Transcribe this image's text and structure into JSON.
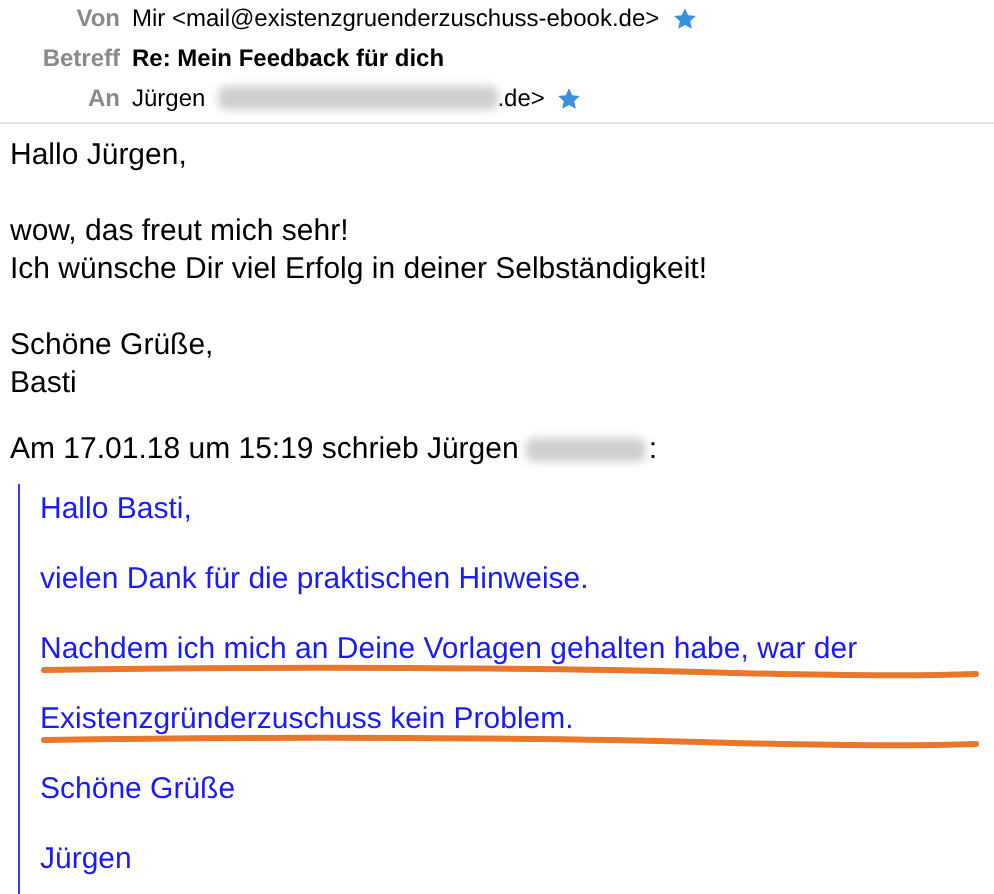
{
  "header": [
    {
      "label": "Von",
      "value": "Mir <mail@existenzgruenderzuschuss-ebook.de>",
      "bold": false,
      "redacted": false,
      "starred": true
    },
    {
      "label": "Betreff",
      "value": "Re: Mein Feedback für dich",
      "bold": true,
      "redacted": false,
      "starred": false
    },
    {
      "label": "An",
      "value": "Jürgen",
      "bold": false,
      "redacted": true,
      "suffix": ".de>",
      "starred": true
    }
  ],
  "body": [
    {
      "kind": "text",
      "text": "Hallo Jürgen,"
    },
    {
      "kind": "gap"
    },
    {
      "kind": "text",
      "text": "wow, das freut mich sehr!"
    },
    {
      "kind": "text",
      "text": "Ich wünsche Dir viel Erfolg in deiner Selbständigkeit!"
    },
    {
      "kind": "gap"
    },
    {
      "kind": "text",
      "text": "Schöne Grüße,"
    },
    {
      "kind": "text",
      "text": "Basti"
    },
    {
      "kind": "gap"
    }
  ],
  "attribution": {
    "text": "Am 17.01.18 um 15:19 schrieb Jürgen",
    "redacted": true,
    "suffix": ":"
  },
  "quote": [
    {
      "text": "Hallo Basti,",
      "highlighted": false
    },
    {
      "text": "vielen Dank für die praktischen Hinweise.",
      "highlighted": false
    },
    {
      "text": "Nachdem ich mich an Deine Vorlagen gehalten habe, war der",
      "highlighted": true
    },
    {
      "text": "Existenzgründerzuschuss kein Problem.",
      "highlighted": true
    },
    {
      "text": "Schöne Grüße",
      "highlighted": false
    },
    {
      "text": "Jürgen",
      "highlighted": false
    }
  ]
}
